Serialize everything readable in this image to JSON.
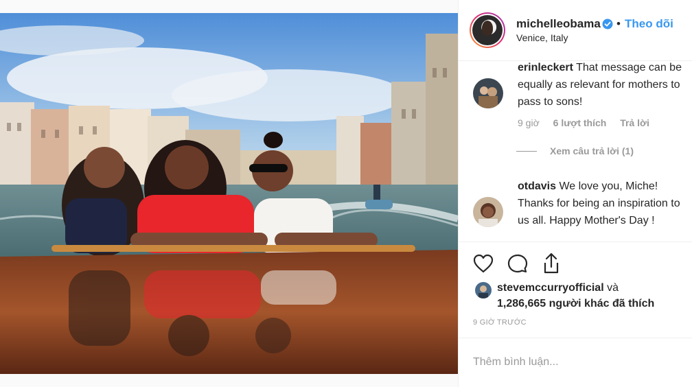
{
  "post": {
    "username": "michelleobama",
    "follow_label": "Theo dõi",
    "separator": "•",
    "location": "Venice, Italy",
    "verified_icon": "verified-badge-icon"
  },
  "comments": [
    {
      "username": "erinleckert",
      "text": "That message can be equally as relevant for mothers to pass to sons!",
      "line1": "That message can be",
      "line2": "equally as relevant for mothers to",
      "line3": "pass to sons!",
      "time": "9 giờ",
      "likes": "6 lượt thích",
      "reply": "Trả lời",
      "view_replies": "Xem câu trả lời (1)"
    },
    {
      "username": "otdavis",
      "line1": "We love you, Miche!",
      "line2": "Thanks for being an inspiration to",
      "line3": "us all. Happy Mother's Day !"
    }
  ],
  "likes": {
    "first_user": "stevemccurryofficial",
    "and_text": "và",
    "count": "1,286,665",
    "others_text": "người khác đã thích"
  },
  "timestamp": "9 GIỜ TRƯỚC",
  "add_comment_placeholder": "Thêm bình luận...",
  "icons": [
    "heart-icon",
    "comment-icon",
    "share-icon"
  ],
  "colors": {
    "accent": "#3897f0",
    "text": "#262626",
    "muted": "#999999"
  }
}
